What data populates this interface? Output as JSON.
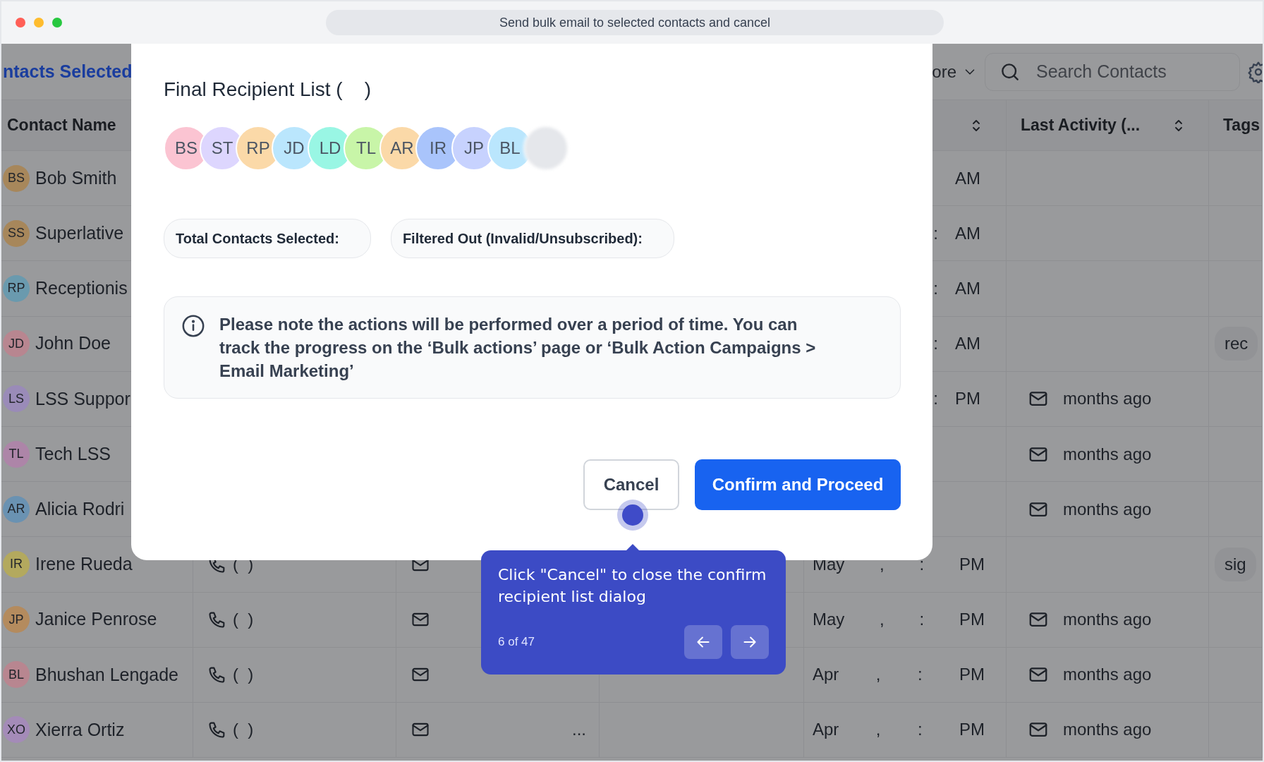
{
  "browser": {
    "title": "Send bulk email to selected contacts and cancel"
  },
  "app": {
    "selection_link": "ntacts Selected",
    "more_menu": "ore",
    "search": {
      "placeholder": "Search Contacts"
    },
    "header": {
      "contact_name": "Contact Name",
      "last_activity": "Last Activity (...",
      "tags": "Tags"
    },
    "rows": [
      {
        "initials": "BS",
        "name": "Bob Smith",
        "color": "#a7875b",
        "date": [
          "AM"
        ]
      },
      {
        "initials": "SS",
        "name": "Superlative",
        "color": "#a7875b",
        "date": [
          ":",
          "AM"
        ]
      },
      {
        "initials": "RP",
        "name": "Receptionis",
        "color": "#6a9aae",
        "date": [
          ":",
          "AM"
        ]
      },
      {
        "initials": "JD",
        "name": "John Doe",
        "color": "#b88690",
        "date": [
          ":",
          "AM"
        ],
        "tag": "rec"
      },
      {
        "initials": "LS",
        "name": "LSS Suppor",
        "color": "#9a8bb8",
        "date": [
          ":",
          "PM"
        ],
        "last_activity": "months ago"
      },
      {
        "initials": "TL",
        "name": "Tech LSS",
        "color": "#ad85a8",
        "last_activity": "months ago"
      },
      {
        "initials": "AR",
        "name": "Alicia Rodri",
        "color": "#6a92b2",
        "last_activity": "months ago"
      },
      {
        "initials": "IR",
        "name": "Irene Rueda",
        "color": "#b3a95e",
        "phone": "(  )",
        "date": [
          "May",
          ",",
          ":",
          "PM"
        ],
        "tag": "sig"
      },
      {
        "initials": "JP",
        "name": "Janice Penrose",
        "color": "#b48b5e",
        "phone": "(  )",
        "date": [
          "May",
          ",",
          ":",
          "PM"
        ],
        "last_activity": "months ago"
      },
      {
        "initials": "BL",
        "name": "Bhushan Lengade",
        "color": "#b88690",
        "phone": "(  )",
        "date": [
          "Apr",
          ",",
          ":",
          "PM"
        ],
        "last_activity": "months ago"
      },
      {
        "initials": "XO",
        "name": "Xierra Ortiz",
        "color": "#a48bb8",
        "phone": "(  )",
        "email_ellipsis": "...",
        "date": [
          "Apr",
          ",",
          ":",
          "PM"
        ],
        "last_activity": "months ago"
      }
    ]
  },
  "modal": {
    "title": "Final Recipient List (    )",
    "recipients": [
      {
        "initials": "BS",
        "color": "#fbc4d2"
      },
      {
        "initials": "ST",
        "color": "#ddd6fe"
      },
      {
        "initials": "RP",
        "color": "#fbd9a8"
      },
      {
        "initials": "JD",
        "color": "#bae6fd"
      },
      {
        "initials": "LD",
        "color": "#99f6e4"
      },
      {
        "initials": "TL",
        "color": "#c8f5a8"
      },
      {
        "initials": "AR",
        "color": "#fbd9a8"
      },
      {
        "initials": "IR",
        "color": "#a9c4fb"
      },
      {
        "initials": "JP",
        "color": "#c7d2fe"
      },
      {
        "initials": "BL",
        "color": "#bae6fd"
      },
      {
        "color": "#e5e7eb"
      }
    ],
    "stats": [
      "Total Contacts Selected:",
      "Filtered Out (Invalid/Unsubscribed):"
    ],
    "notice": "Please note the actions will be performed over a period of time. You can track the progress on the ‘Bulk actions’ page or ‘Bulk Action Campaigns > Email Marketing’",
    "buttons": [
      {
        "label": "Cancel",
        "kind": "secondary"
      },
      {
        "label": "Confirm and Proceed",
        "kind": "primary"
      }
    ]
  },
  "tooltip": {
    "text": "Click \"Cancel\" to close the confirm recipient list dialog",
    "step": "6 of 47"
  }
}
